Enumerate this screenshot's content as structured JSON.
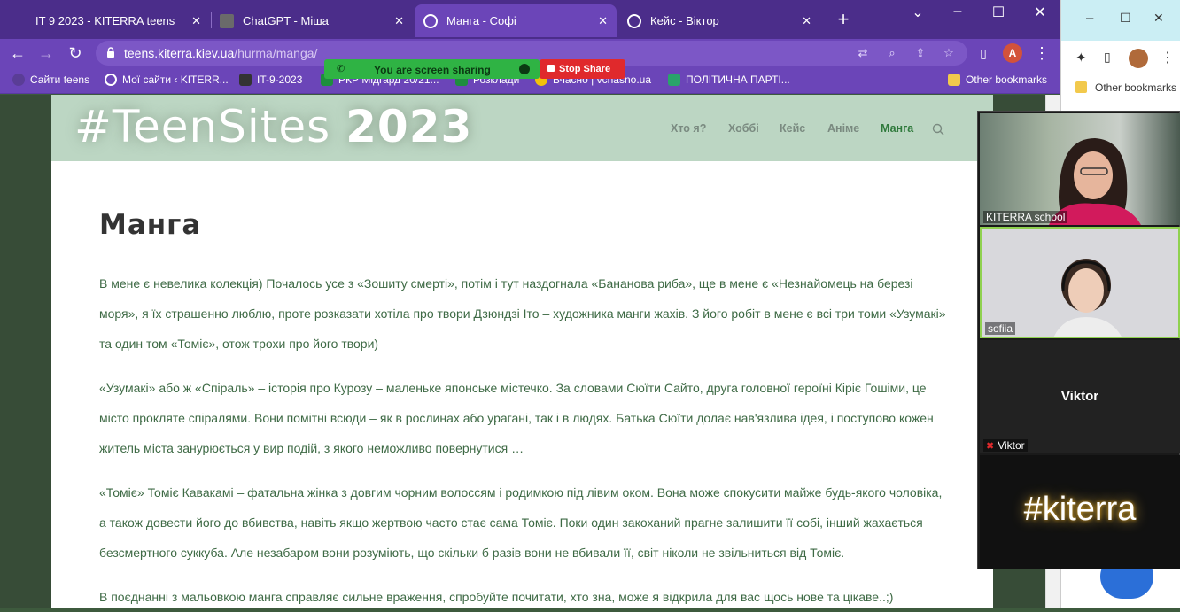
{
  "tabs": [
    {
      "title": "IT 9 2023 - KITERRA teens"
    },
    {
      "title": "ChatGPT - Міша"
    },
    {
      "title": "Манга - Софі"
    },
    {
      "title": "Кейс - Віктор"
    }
  ],
  "address_bar": {
    "host": "teens.kiterra.kiev.ua",
    "path": "/hurma/manga/"
  },
  "profile_initial": "A",
  "bookmarks": [
    {
      "label": "Сайти teens"
    },
    {
      "label": "Мої сайти ‹ KITERR..."
    },
    {
      "label": "IT-9-2023"
    },
    {
      "label": "РКР Мідгард 20/21..."
    },
    {
      "label": "Розклади"
    },
    {
      "label": "Вчасно | vchasno.ua"
    },
    {
      "label": "ПОЛІТИЧНА ПАРТІ..."
    }
  ],
  "other_bookmarks": "Other bookmarks",
  "screen_share": {
    "status": "You are screen sharing",
    "stop": "Stop Share"
  },
  "site": {
    "logo_text": "#TeenSites",
    "logo_year": "2023",
    "nav": [
      "Хто я?",
      "Хоббі",
      "Кейс",
      "Аніме",
      "Манга"
    ]
  },
  "page": {
    "title": "Манга",
    "paragraphs": [
      "В мене є невелика колекція) Почалось усе з «Зошиту смерті», потім і тут наздогнала «Бананова риба», ще в мене є «Незнайомець на березі моря», я їх страшенно люблю, проте розказати хотіла про твори Дзюндзі Іто – художника манги жахів. З його робіт в мене є всі три томи «Узумакі» та один том «Томіє», отож трохи про його твори)",
      "«Узумакі» або ж «Спіраль» – історія про Курозу – маленьке японське містечко. За словами Сюїти Сайто, друга головної героїні Кіріє Гошіми, це місто прокляте спіралями. Вони помітні всюди – як в рослинах або урагані, так і в людях. Батька Сюїти долає нав'язлива ідея, і поступово кожен житель міста занурюється у вир подій, з якого неможливо повернутися …",
      "«Томіє» Томіє Кавакамі – фатальна жінка з довгим чорним волоссям і родимкою під лівим оком. Вона може спокусити майже будь-якого чоловіка, а також довести його до вбивства, навіть якщо жертвою часто стає сама Томіє. Поки один закоханий прагне залишити її собі, інший жахається безсмертного суккуба. Але незабаром вони розуміють, що скільки б разів вони не вбивали її, світ ніколи не звільниться від Томіє.",
      "В поєднанні з мальовкою манга справляє сильне враження, спробуйте почитати, хто зна, може я відкрила для вас щось нове та цікаве..;)"
    ]
  },
  "zoom": {
    "participants": [
      {
        "name": "KITERRA school"
      },
      {
        "name": "sofiia"
      },
      {
        "name": "Viktor",
        "label": "Viktor"
      }
    ],
    "kiterra_tag": "#kiterra"
  }
}
